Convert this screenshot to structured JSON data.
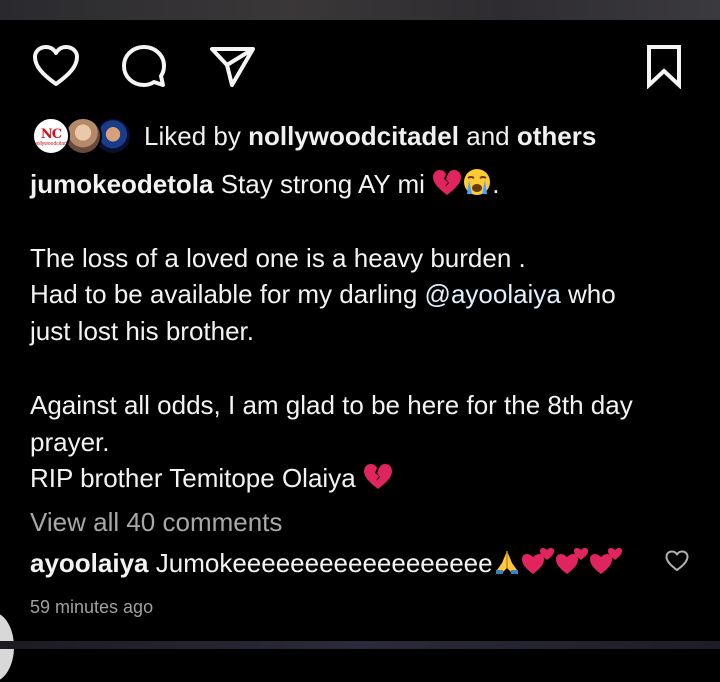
{
  "actions": {
    "like_icon": "heart-outline-icon",
    "comment_icon": "comment-bubble-icon",
    "share_icon": "paper-plane-icon",
    "save_icon": "bookmark-icon"
  },
  "likes": {
    "prefix": "Liked by",
    "user": "nollywoodcitadel",
    "conjunction": "and",
    "others": "others",
    "avatar_logo_text": "NC",
    "avatar_logo_sub": "nollywoodcitadel"
  },
  "post": {
    "username": "jumokeodetola",
    "line1": " Stay strong AY mi ",
    "line1_end": ".",
    "para2_line1": "The loss of a loved one is a heavy burden .",
    "para2_line2_prefix": "Had to be available for my darling ",
    "mention": "@ayoolaiya",
    "para2_line2_suffix": " who",
    "para2_line3": "just lost his brother.",
    "para3_line1": "Against all odds, I am glad to be here for the 8th day",
    "para3_line2": "prayer.",
    "para3_line3": "RIP brother Temitope Olaiya "
  },
  "view_all_comments": "View all 40 comments",
  "comment": {
    "username": "ayoolaiya",
    "text": " Jumokeeeeeeeeeeeeeeeeee"
  },
  "timestamp": "59 minutes ago",
  "colors": {
    "background": "#000000",
    "text": "#f3f3f3",
    "muted": "#a8a8a8",
    "broken_heart": "#e0245e"
  }
}
